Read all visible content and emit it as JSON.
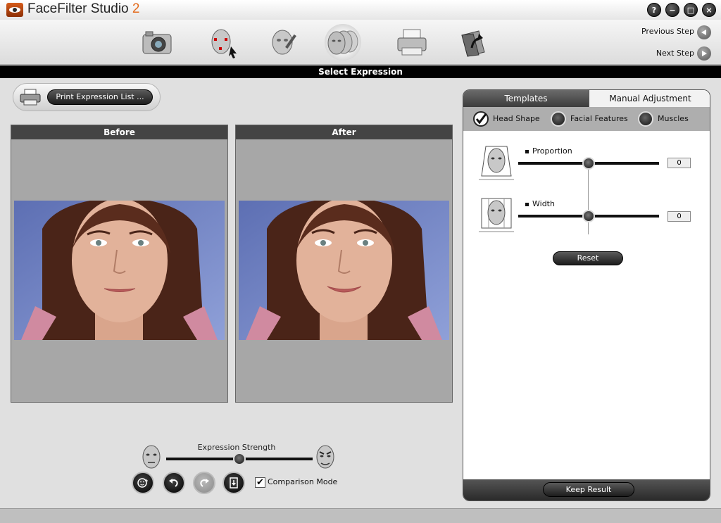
{
  "app": {
    "title": "FaceFilter Studio",
    "version": "2"
  },
  "window_controls": [
    {
      "name": "help",
      "glyph": "?"
    },
    {
      "name": "minimize",
      "glyph": "−"
    },
    {
      "name": "maximize",
      "glyph": "□"
    },
    {
      "name": "close",
      "glyph": "×"
    }
  ],
  "toolbar": {
    "tools": [
      {
        "name": "camera-icon"
      },
      {
        "name": "face-points-icon"
      },
      {
        "name": "retouch-icon"
      },
      {
        "name": "expressions-icon",
        "active": true
      },
      {
        "name": "printer-icon"
      },
      {
        "name": "export-icon"
      }
    ],
    "previous_step": "Previous Step",
    "next_step": "Next Step"
  },
  "section_title": "Select Expression",
  "print_list_button": "Print Expression List ...",
  "panels": {
    "before": "Before",
    "after": "After"
  },
  "expression_strength": {
    "label": "Expression Strength",
    "value_fraction": 0.5
  },
  "comparison_mode": {
    "label": "Comparison Mode",
    "checked": true,
    "check_glyph": "✔"
  },
  "right_panel": {
    "tabs": [
      "Templates",
      "Manual Adjustment"
    ],
    "active_tab": "Manual Adjustment",
    "subtabs": [
      "Head Shape",
      "Facial Features",
      "Muscles"
    ],
    "active_subtab": "Head Shape",
    "adjustments": [
      {
        "label": "Proportion",
        "value": "0",
        "fraction": 0.5
      },
      {
        "label": "Width",
        "value": "0",
        "fraction": 0.5
      }
    ],
    "reset_button": "Reset",
    "keep_result_button": "Keep Result"
  },
  "colors": {
    "accent": "#e36a1c",
    "panel_bg": "#a7a7a7",
    "header_bg": "#444444"
  }
}
